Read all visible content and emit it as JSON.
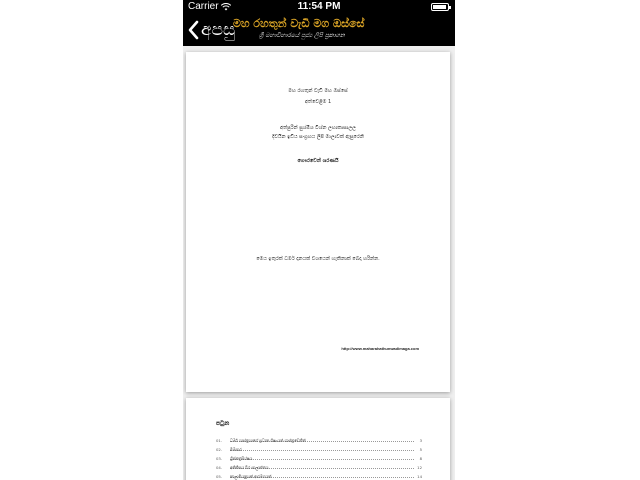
{
  "status_bar": {
    "carrier": "Carrier",
    "time": "11:54 PM",
    "battery_level": 0.9
  },
  "nav": {
    "back_label": "අපසු",
    "title": "මහ රහතුන් වැඩි මග ඔස්සේ",
    "subtitle": "ශ්‍රී මහාවිහාරයේ පුජ්‍ය ලිපි ප්‍රකාශන"
  },
  "page1": {
    "line1": "මහ රහතුන් වැඩි මහ ඔස්සේ",
    "line2": "අත්වෙළිම 1",
    "line3": "අත්පුරින් සුශ්මිශ විශ්න ලහාකාසාලල",
    "line4": "දිවයින ඉඩිය සංග්‍රහය ලිපි මාලාවක් ඇසුරෙනි",
    "line5": "ගෞරවෙන් ශරණයි",
    "line6": "මෙය ඉතුරක් ධර්ම දානයක් වශයෙන් හැකිනාක් බෙදා හරින්න.",
    "url": "http://www.maharahathunwadimaga.com"
  },
  "page2": {
    "toc_title": "පටුන",
    "items": [
      {
        "num": "01.",
        "title": "ධර්ම ශාස්ත්‍රයාගේ ප්‍රධාන ශිෂ්‍යයන් ශාස්ත්‍රවෙතීන්",
        "page": "3"
      },
      {
        "num": "02.",
        "title": "බිම්සාර",
        "page": "5"
      },
      {
        "num": "03.",
        "title": "ශ්‍රීජනත්‍රසිය්ෂය",
        "page": "8"
      },
      {
        "num": "04.",
        "title": "අනිතීසය වීර සාලාත්තය",
        "page": "12"
      },
      {
        "num": "05.",
        "title": "කාලාමියනුයක් ආරම්භයක්",
        "page": "14"
      }
    ]
  }
}
